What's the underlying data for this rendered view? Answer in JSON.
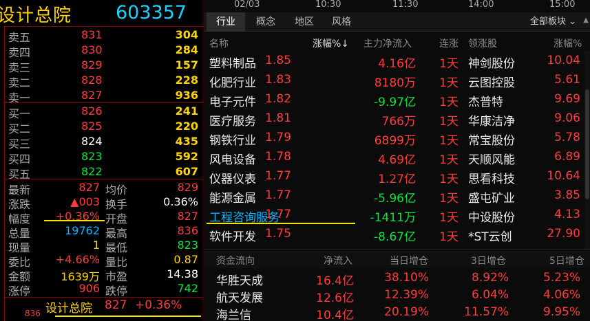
{
  "stock": {
    "name": "设计总院",
    "code": "603357"
  },
  "order_book": {
    "asks": [
      {
        "label": "卖五",
        "price": "831",
        "volume": "304"
      },
      {
        "label": "卖四",
        "price": "830",
        "volume": "284"
      },
      {
        "label": "卖三",
        "price": "829",
        "volume": "157"
      },
      {
        "label": "卖二",
        "price": "828",
        "volume": "228"
      },
      {
        "label": "卖一",
        "price": "827",
        "volume": "936"
      }
    ],
    "bids": [
      {
        "label": "买一",
        "price": "826",
        "volume": "241"
      },
      {
        "label": "买二",
        "price": "825",
        "volume": "220"
      },
      {
        "label": "买三",
        "price": "824",
        "volume": "435"
      },
      {
        "label": "买四",
        "price": "823",
        "volume": "592"
      },
      {
        "label": "买五",
        "price": "822",
        "volume": "607"
      }
    ]
  },
  "quote": [
    {
      "l1": "最新",
      "v1": "827",
      "l2": "均价",
      "v2": "829"
    },
    {
      "l1": "涨跌",
      "v1": "▲003",
      "l2": "换手",
      "v2": "0.36%"
    },
    {
      "l1": "幅度",
      "v1": "+0.36%",
      "l2": "开盘",
      "v2": "827"
    },
    {
      "l1": "总量",
      "v1": "19762",
      "l2": "最高",
      "v2": "836"
    },
    {
      "l1": "现量",
      "v1": "1",
      "l2": "最低",
      "v2": "823"
    },
    {
      "l1": "委比",
      "v1": "+4.66%",
      "l2": "量比",
      "v2": "0.87"
    },
    {
      "l1": "金额",
      "v1": "1639万",
      "l2": "市盈",
      "v2": "14.38"
    },
    {
      "l1": "涨停",
      "v1": "906",
      "l2": "跌停",
      "v2": "742"
    }
  ],
  "bottom_ticker": {
    "small_value": "836",
    "name": "设计总院",
    "price": "827",
    "change": "+0.36%"
  },
  "timebar": [
    "02/03",
    "10:30",
    "11:30",
    "14:00",
    "15:00"
  ],
  "tabs": [
    "行业",
    "概念",
    "地区",
    "风格"
  ],
  "all_boards_label": "全部板块",
  "sector_columns": {
    "name": "名称",
    "pct": "涨幅%↓",
    "flow": "主力净流入",
    "days": "连涨",
    "lead": "领涨股",
    "lpct": "涨幅%"
  },
  "sectors": [
    {
      "name": "塑料制品",
      "pct": "1.85",
      "flow": "4.16",
      "unit": "亿",
      "dir": "in",
      "days": "1天",
      "lead": "神剑股份",
      "lpct": "10.04"
    },
    {
      "name": "化肥行业",
      "pct": "1.83",
      "flow": "8180",
      "unit": "万",
      "dir": "in",
      "days": "1天",
      "lead": "云图控股",
      "lpct": "5.61"
    },
    {
      "name": "电子元件",
      "pct": "1.82",
      "flow": "-9.97",
      "unit": "亿",
      "dir": "out",
      "days": "1天",
      "lead": "杰普特",
      "lpct": "9.69"
    },
    {
      "name": "医疗服务",
      "pct": "1.81",
      "flow": "766",
      "unit": "万",
      "dir": "in",
      "days": "1天",
      "lead": "华康洁净",
      "lpct": "9.06"
    },
    {
      "name": "钢铁行业",
      "pct": "1.79",
      "flow": "6899",
      "unit": "万",
      "dir": "in",
      "days": "1天",
      "lead": "常宝股份",
      "lpct": "5.78"
    },
    {
      "name": "风电设备",
      "pct": "1.78",
      "flow": "4.69",
      "unit": "亿",
      "dir": "in",
      "days": "1天",
      "lead": "天顺风能",
      "lpct": "6.89"
    },
    {
      "name": "仪器仪表",
      "pct": "1.77",
      "flow": "1.27",
      "unit": "亿",
      "dir": "in",
      "days": "1天",
      "lead": "思看科技",
      "lpct": "10.64"
    },
    {
      "name": "能源金属",
      "pct": "1.77",
      "flow": "-5.96",
      "unit": "亿",
      "dir": "out",
      "days": "1天",
      "lead": "盛屯矿业",
      "lpct": "3.85"
    },
    {
      "name": "工程咨询服务",
      "pct": "1.77",
      "flow": "-1411",
      "unit": "万",
      "dir": "out",
      "days": "1天",
      "lead": "中设股份",
      "lpct": "4.13",
      "highlight": true
    },
    {
      "name": "软件开发",
      "pct": "1.75",
      "flow": "-8.67",
      "unit": "亿",
      "dir": "out",
      "days": "1天",
      "lead": "*ST云创",
      "lpct": "27.90"
    }
  ],
  "fund_columns": {
    "name": "资金流向",
    "flow": "净流入",
    "d1": "当日增仓",
    "d3": "3日增仓",
    "d5": "5日增仓"
  },
  "funds": [
    {
      "name": "华胜天成",
      "flow": "16.4亿",
      "d1": "38.10%",
      "d3": "8.92%",
      "d5": "5.23%"
    },
    {
      "name": "航天发展",
      "flow": "12.6亿",
      "d1": "12.39%",
      "d3": "6.04%",
      "d5": "4.06%"
    },
    {
      "name": "海兰信",
      "flow": "10.4亿",
      "d1": "20.19%",
      "d3": "11.57%",
      "d5": "9.95%"
    }
  ],
  "colors": {
    "up": "#ff3b3b",
    "down": "#00e640",
    "highlight": "#ffd500",
    "code": "#19d3ff",
    "selected_sector": "#00b7ff"
  }
}
